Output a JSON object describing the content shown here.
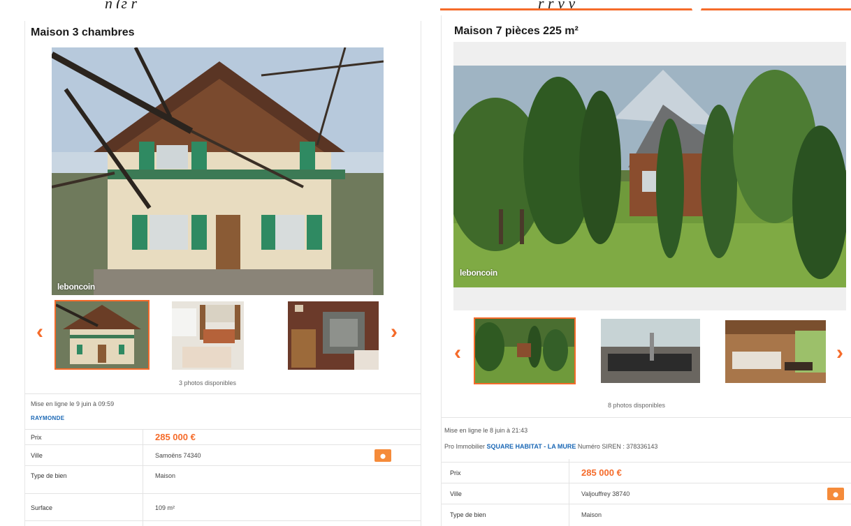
{
  "left_listing": {
    "title": "Maison 3 chambres",
    "watermark": "leboncoin",
    "photo_count": "3 photos disponibles",
    "posted": "Mise en ligne le 9 juin à 09:59",
    "seller": "RAYMONDE",
    "details": [
      {
        "label": "Prix",
        "value": "285 000 €"
      },
      {
        "label": "Ville",
        "value": "Samoëns 74340"
      },
      {
        "label": "Type de bien",
        "value": "Maison"
      },
      {
        "label": "Surface",
        "value": "109 m²"
      }
    ]
  },
  "right_listing": {
    "title": "Maison 7 pièces 225 m²",
    "watermark": "leboncoin",
    "photo_count": "8 photos disponibles",
    "posted": "Mise en ligne le 8 juin à 21:43",
    "pro_prefix": "Pro Immobilier",
    "pro_name": "SQUARE HABITAT - LA MURE",
    "siren": "Numéro SIREN : 378336143",
    "details": [
      {
        "label": "Prix",
        "value": "285 000 €"
      },
      {
        "label": "Ville",
        "value": "Valjouffrey 38740"
      },
      {
        "label": "Type de bien",
        "value": "Maison"
      }
    ]
  },
  "icons": {
    "prev": "‹",
    "next": "›",
    "map_pin": "⬤"
  },
  "colors": {
    "accent": "#f56b2a",
    "link": "#1a67b5"
  }
}
